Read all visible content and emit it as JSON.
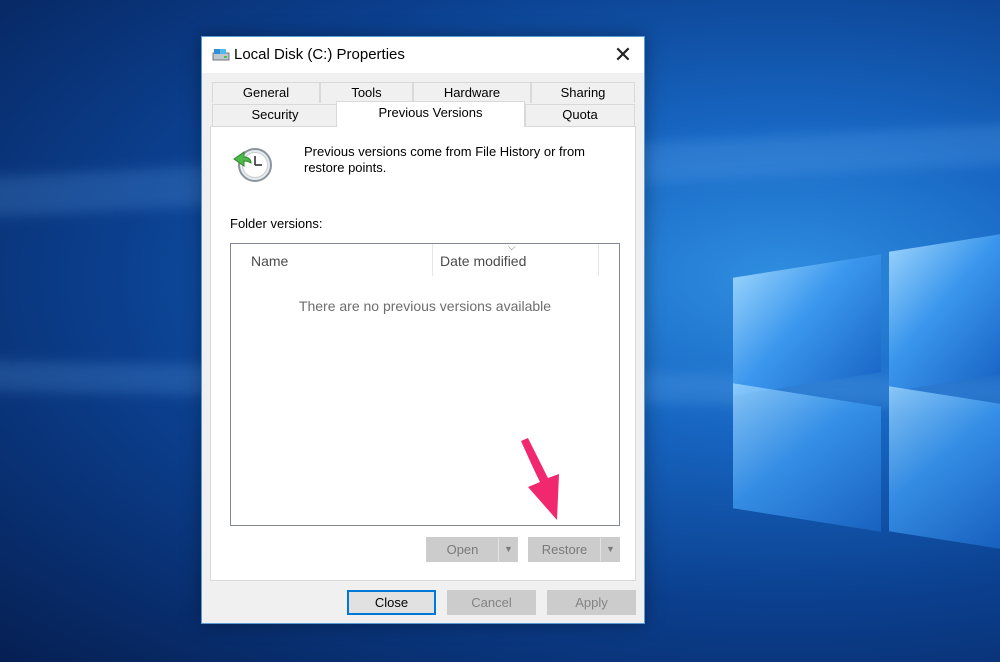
{
  "window": {
    "title": "Local Disk (C:) Properties",
    "close_glyph": "✕"
  },
  "tabs_row1": [
    {
      "label": "General"
    },
    {
      "label": "Tools"
    },
    {
      "label": "Hardware"
    },
    {
      "label": "Sharing"
    }
  ],
  "tabs_row2": [
    {
      "label": "Security"
    },
    {
      "label": "Previous Versions"
    },
    {
      "label": "Quota"
    }
  ],
  "active_tab": "Previous Versions",
  "info": {
    "text": "Previous versions come from File History or from restore points."
  },
  "versions": {
    "label": "Folder versions:",
    "columns": [
      "Name",
      "Date modified"
    ],
    "empty_message": "There are no previous versions available"
  },
  "actions": {
    "open_label": "Open",
    "restore_label": "Restore"
  },
  "footer": {
    "close_label": "Close",
    "cancel_label": "Cancel",
    "apply_label": "Apply"
  },
  "colors": {
    "accent": "#0078d7",
    "annotation_arrow": "#f2286e"
  },
  "icons": {
    "title": "drive-icon",
    "info": "clock-restore-icon",
    "dropdown": "caret-down-icon"
  }
}
